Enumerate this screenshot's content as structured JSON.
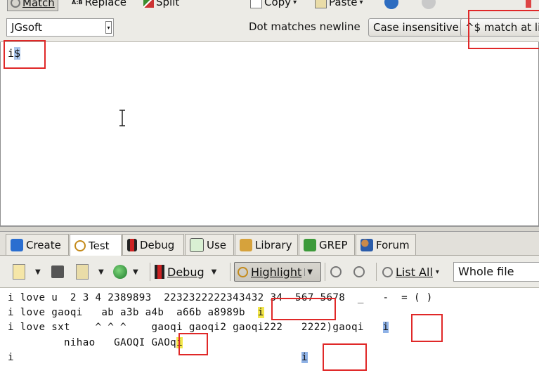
{
  "toolbar": {
    "match": "Match",
    "replace": "Replace",
    "split": "Split",
    "copy": "Copy",
    "paste": "Paste"
  },
  "options": {
    "flavor": "JGsoft",
    "dot_newline": "Dot matches newline",
    "case": "Case insensitive",
    "anchor": "^$ match at li"
  },
  "regex": {
    "plain": "i",
    "selected": "$"
  },
  "tabs": [
    "Create",
    "Test",
    "Debug",
    "Use",
    "Library",
    "GREP",
    "Forum"
  ],
  "test_toolbar": {
    "debug": "Debug",
    "highlight": "Highlight",
    "list_all": "List All",
    "scope": "Whole file"
  },
  "test_lines": [
    {
      "pre": "i love u  2 3 4 2389893  2232322222343432 34  567 5678  _   -  = ( )",
      "hl": "",
      "post": ""
    },
    {
      "pre": "i love gaoqi   ab a3b a4b  a66b a8989b  ",
      "hl": "i",
      "post": ""
    },
    {
      "pre": "i love sxt    ^ ^ ^    gaoqi gaoqi2 gaoqi222   2222)gaoqi   ",
      "hl": "i",
      "post": ""
    },
    {
      "pre": "         nihao   GAOQI GAOq",
      "hl": "i",
      "post": ""
    },
    {
      "pre": "i                                              ",
      "hl": "i",
      "post": ""
    }
  ],
  "colors": {
    "highlight_yellow": "#f2e64a",
    "highlight_blue": "#8fb2e6",
    "annotation_red": "#e02828",
    "toolbar_bg": "#ecebe6"
  }
}
